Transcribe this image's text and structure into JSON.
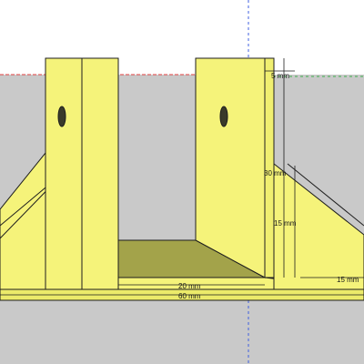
{
  "viewport": {
    "sky_color": "#ffffff",
    "ground_color": "#c9c9c9",
    "model_color": "#f5f37a",
    "model_shadow_color": "#a3a34a",
    "edge_color": "#1e1e1e",
    "axis_red": "#e04040",
    "axis_green": "#3cb04a",
    "axis_blue": "#4060e0"
  },
  "dimensions": {
    "top_thickness": "5 mm",
    "height_upper": "30 mm",
    "height_lower": "15 mm",
    "base_extension": "15 mm",
    "inner_width": "20 mm",
    "overall_width": "60 mm"
  },
  "model": {
    "name_icon": "bracket-model",
    "holes": 2
  }
}
